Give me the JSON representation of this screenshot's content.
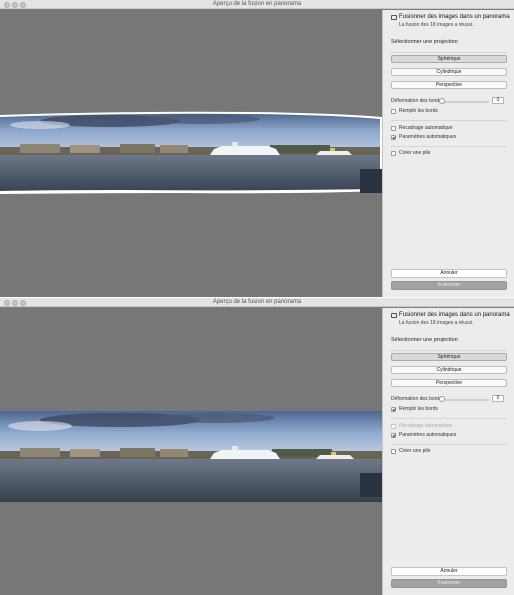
{
  "windows": [
    {
      "title": "Aperçu de la fusion en panorama",
      "panel": {
        "header_title": "Fusionner des images dans un panorama",
        "header_subtitle": "La fusion des 18 images a réussi.",
        "projection_label": "Sélectionner une projection",
        "projections": [
          {
            "label": "Sphérique",
            "selected": true
          },
          {
            "label": "Cylindrique",
            "selected": false
          },
          {
            "label": "Perspective",
            "selected": false
          }
        ],
        "boundary_warp_label": "Déformation des bords",
        "boundary_warp_value": "0",
        "fill_edges_label": "Remplir les bords",
        "fill_edges_checked": false,
        "auto_crop_label": "Recadrage automatique",
        "auto_crop_checked": false,
        "auto_crop_disabled": false,
        "auto_settings_label": "Paramètres automatiques",
        "auto_settings_checked": true,
        "create_stack_label": "Créer une pile",
        "create_stack_checked": false,
        "cancel_label": "Annuler",
        "merge_label": "Fusionner"
      }
    },
    {
      "title": "Aperçu de la fusion en panorama",
      "panel": {
        "header_title": "Fusionner des images dans un panorama",
        "header_subtitle": "La fusion des 18 images a réussi.",
        "projection_label": "Sélectionner une projection",
        "projections": [
          {
            "label": "Sphérique",
            "selected": true
          },
          {
            "label": "Cylindrique",
            "selected": false
          },
          {
            "label": "Perspective",
            "selected": false
          }
        ],
        "boundary_warp_label": "Déformation des bords",
        "boundary_warp_value": "0",
        "fill_edges_label": "Remplir les bords",
        "fill_edges_checked": true,
        "auto_crop_label": "Recadrage automatique",
        "auto_crop_checked": false,
        "auto_crop_disabled": true,
        "auto_settings_label": "Paramètres automatiques",
        "auto_settings_checked": true,
        "create_stack_label": "Créer une pile",
        "create_stack_checked": false,
        "cancel_label": "Annuler",
        "merge_label": "Fusionner"
      }
    }
  ],
  "colors": {
    "window_bg": "#7b7b7b",
    "panel_bg": "#ececec",
    "selected_button": "#d9d9d9",
    "merge_button": "#a2a2a2",
    "sky": "#8fa6c8",
    "water": "#4a5566"
  },
  "icons": [
    "close-icon",
    "minimize-icon",
    "zoom-icon",
    "panorama-icon",
    "checkmark-icon"
  ]
}
